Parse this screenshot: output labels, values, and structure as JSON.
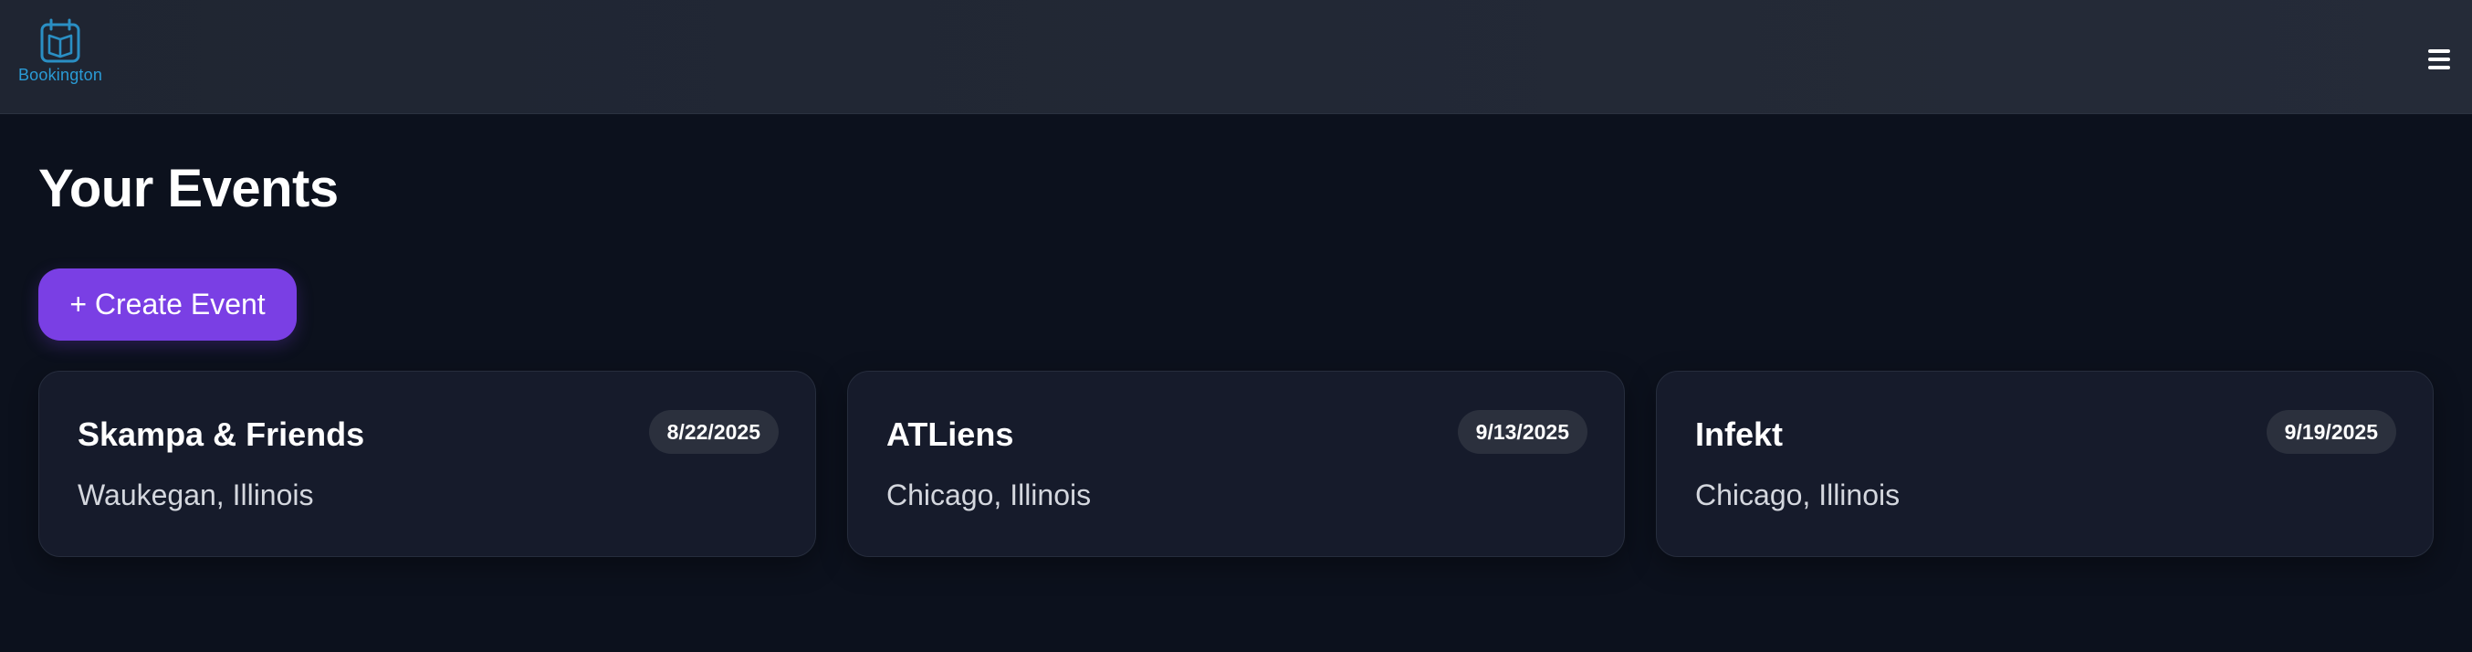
{
  "brand": {
    "name": "Bookington",
    "logo_icon": "calendar-book-icon",
    "accent_color": "#2a9bd6"
  },
  "header": {
    "menu_icon": "hamburger-menu-icon"
  },
  "main": {
    "title": "Your Events",
    "create_button_label": "+ Create Event",
    "create_button_color": "#7a3fe4"
  },
  "events": [
    {
      "title": "Skampa & Friends",
      "date": "8/22/2025",
      "location": "Waukegan, Illinois"
    },
    {
      "title": "ATLiens",
      "date": "9/13/2025",
      "location": "Chicago, Illinois"
    },
    {
      "title": "Infekt",
      "date": "9/19/2025",
      "location": "Chicago, Illinois"
    }
  ]
}
